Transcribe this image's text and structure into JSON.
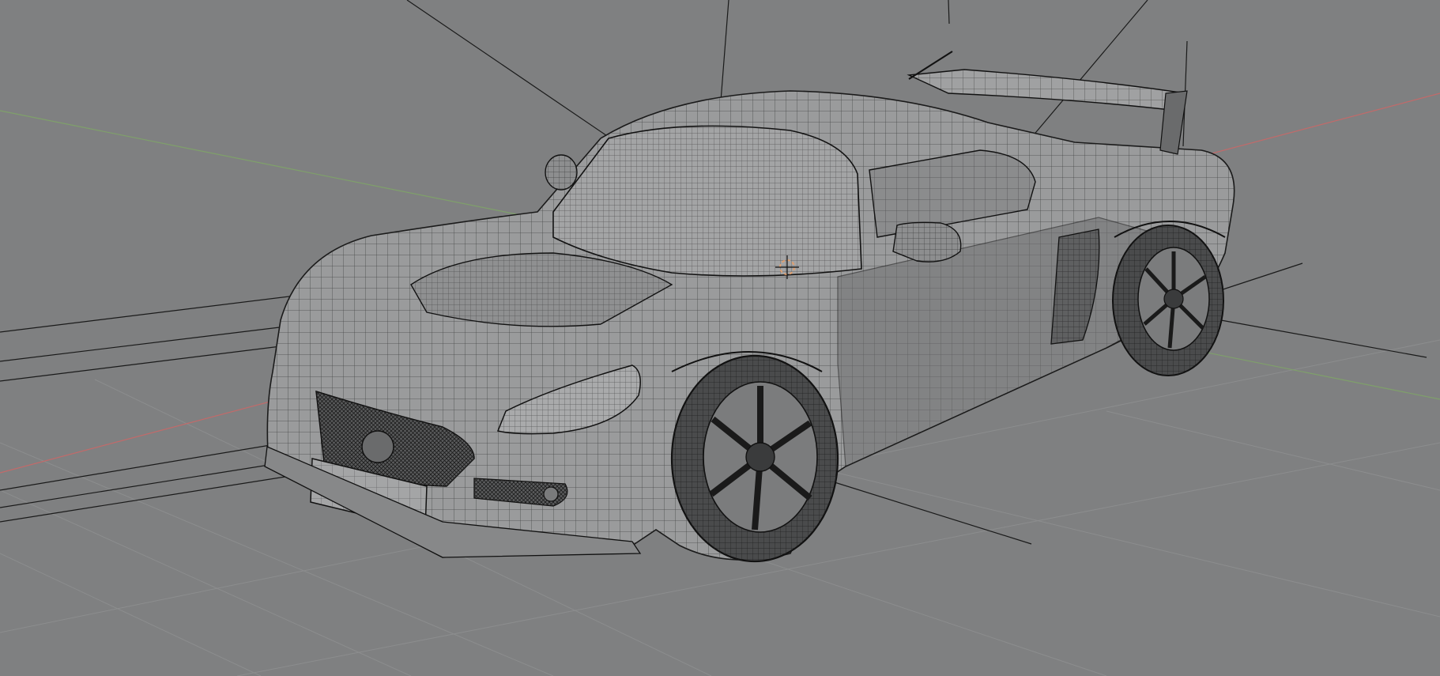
{
  "viewport": {
    "background": "#7f8081",
    "axis_x_color": "#c26a6a",
    "axis_y_color": "#7fa06a",
    "mesh_fill": "#9a9b9c",
    "mesh_shadow": "#6f7071",
    "wire_color": "#2a2a2a",
    "cursor_color": "#e0a070"
  },
  "scene": {
    "object": "car-body-mesh",
    "shading": "solid-wireframe",
    "grid": "on"
  }
}
